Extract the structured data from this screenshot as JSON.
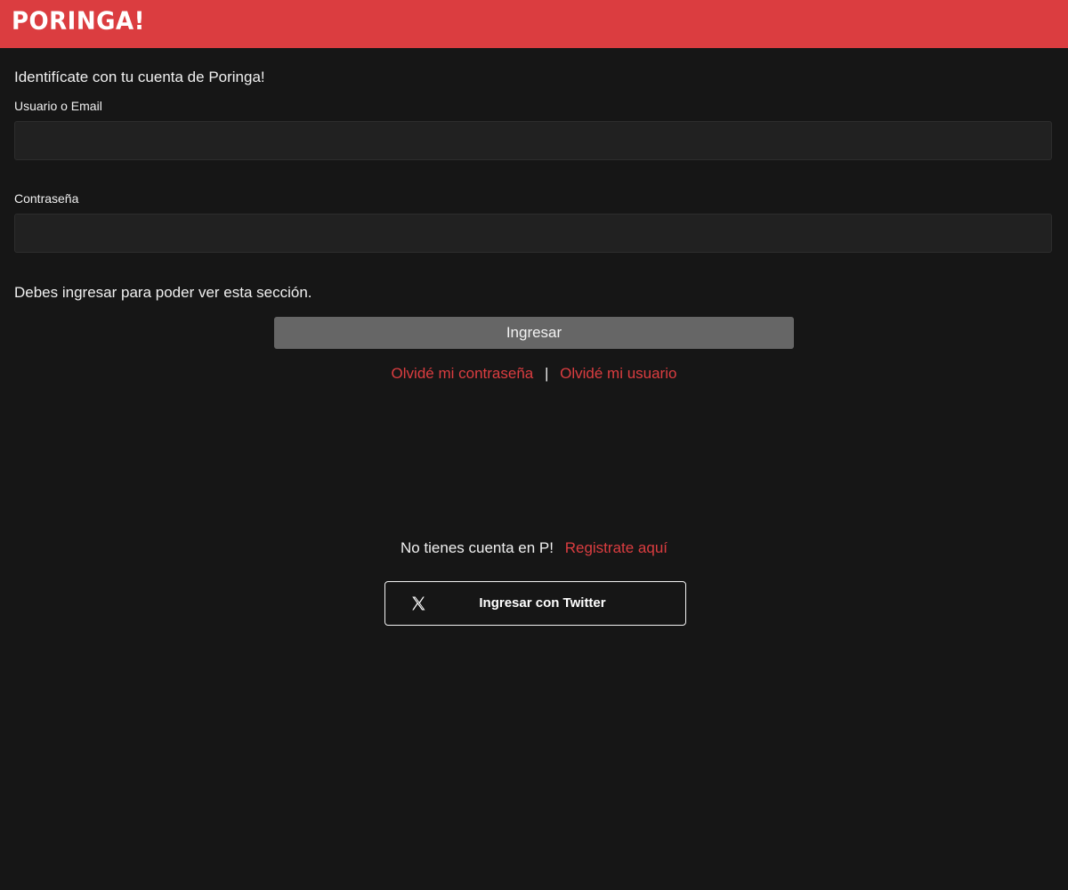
{
  "header": {
    "logo_text": "PORINGA!",
    "brand_color": "#db3d40"
  },
  "login": {
    "intro": "Identifícate con tu cuenta de Poringa!",
    "user_label": "Usuario o Email",
    "user_value": "",
    "password_label": "Contraseña",
    "password_value": "",
    "notice": "Debes ingresar para poder ver esta sección.",
    "submit_label": "Ingresar",
    "forgot_password": "Olvidé mi contraseña",
    "separator": "|",
    "forgot_user": "Olvidé mi usuario"
  },
  "register": {
    "prompt": "No tienes cuenta en P!",
    "link": "Registrate aquí"
  },
  "social": {
    "twitter_label": "Ingresar con Twitter",
    "icon": "x-logo-icon"
  },
  "colors": {
    "background": "#161616",
    "field_bg": "#212121",
    "button_bg": "#666666",
    "link": "#db3d40"
  }
}
